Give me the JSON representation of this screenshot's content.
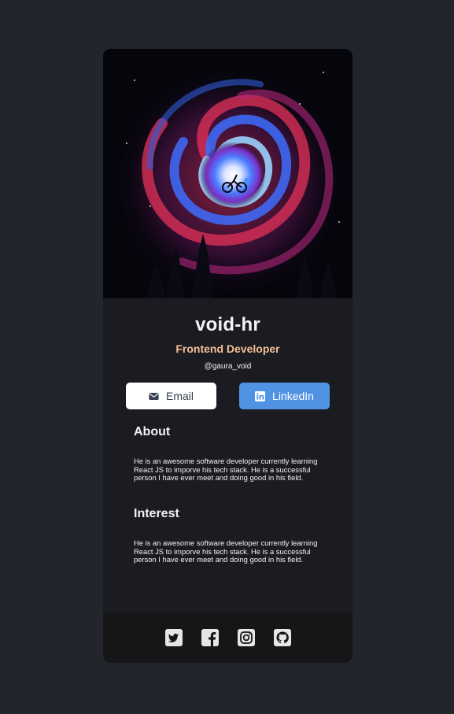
{
  "profile": {
    "name": "void-hr",
    "title": "Frontend Developer",
    "handle": "@gaura_void"
  },
  "actions": {
    "email_label": "Email",
    "linkedin_label": "LinkedIn"
  },
  "about": {
    "heading": "About",
    "text": "He is an awesome software developer currently learning React JS to imporve his tech stack. He is a successful person I have ever meet and doing good in his field."
  },
  "interest": {
    "heading": "Interest",
    "text": "He is an awesome software developer currently learning React JS to imporve his tech stack. He is a successful person I have ever meet and doing good in his field."
  },
  "footer": {
    "icons": [
      "twitter-icon",
      "facebook-icon",
      "instagram-icon",
      "github-icon"
    ]
  },
  "colors": {
    "background": "#23252c",
    "card": "#1b1c21",
    "footer": "#161619",
    "accent_role": "#f3bf99",
    "linkedin_button": "#5093e2",
    "email_button": "#ffffff"
  }
}
